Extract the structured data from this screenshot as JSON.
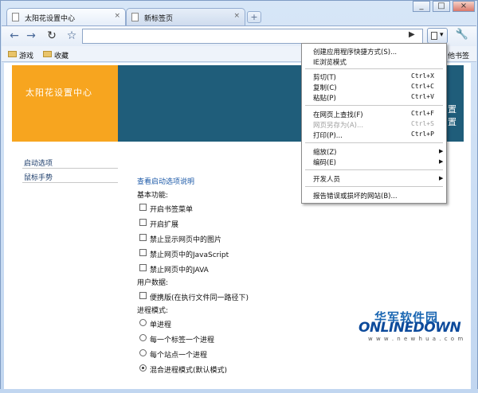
{
  "tabs": [
    {
      "label": "太阳花设置中心",
      "close": "×"
    },
    {
      "label": "新标签页",
      "close": "×"
    }
  ],
  "newtab_icon": "+",
  "window_controls": [
    "_",
    "□",
    "×"
  ],
  "toolbar": {
    "back": "←",
    "forward": "→",
    "reload": "↻",
    "star": "☆",
    "go": "▶",
    "page_menu": "▾",
    "wrench": "🔧"
  },
  "bookmarks": [
    {
      "label": "游戏"
    },
    {
      "label": "收藏"
    }
  ],
  "bookmarks_other": "他书签",
  "banner": {
    "title": "太阳花设置中心",
    "right_partial": "置\n置"
  },
  "sidebar": [
    {
      "label": "启动选项"
    },
    {
      "label": "鼠标手势"
    }
  ],
  "content": {
    "link": "查看启动选项说明",
    "section1": "基本功能:",
    "options1": [
      "开启书签菜单",
      "开启扩展",
      "禁止显示网页中的图片",
      "禁止网页中的JavaScript",
      "禁止网页中的JAVA"
    ],
    "section2": "用户数据:",
    "options2": [
      "便携版(在执行文件同一路径下)"
    ],
    "section3": "进程模式:",
    "radios": [
      "单进程",
      "每一个标签一个进程",
      "每个站点一个进程",
      "混合进程模式(默认模式)"
    ],
    "radio_selected": 3
  },
  "menu": {
    "items": [
      {
        "label": "创建应用程序快捷方式(S)...",
        "shortcut": "",
        "arrow": ""
      },
      {
        "label": "IE浏览模式",
        "shortcut": "",
        "arrow": ""
      },
      {
        "label": "剪切(T)",
        "shortcut": "Ctrl+X",
        "arrow": ""
      },
      {
        "label": "复制(C)",
        "shortcut": "Ctrl+C",
        "arrow": ""
      },
      {
        "label": "粘贴(P)",
        "shortcut": "Ctrl+V",
        "arrow": ""
      },
      {
        "label": "在网页上查找(F)",
        "shortcut": "Ctrl+F",
        "arrow": ""
      },
      {
        "label": "网页另存为(A)...",
        "shortcut": "Ctrl+S",
        "arrow": ""
      },
      {
        "label": "打印(P)...",
        "shortcut": "Ctrl+P",
        "arrow": ""
      },
      {
        "label": "缩放(Z)",
        "shortcut": "",
        "arrow": "▶"
      },
      {
        "label": "编码(E)",
        "shortcut": "",
        "arrow": "▶"
      },
      {
        "label": "开发人员",
        "shortcut": "",
        "arrow": "▶"
      },
      {
        "label": "报告错误或损坏的网站(B)...",
        "shortcut": "",
        "arrow": ""
      }
    ]
  },
  "watermark": {
    "cn": "华军软件园",
    "en": "ONLINEDOWN",
    "url": "w w w . n e w h u a . c o m"
  },
  "colors": {
    "banner_left": "#f7a51f",
    "banner_right": "#1f5d7a",
    "link": "#1d5aa8"
  }
}
